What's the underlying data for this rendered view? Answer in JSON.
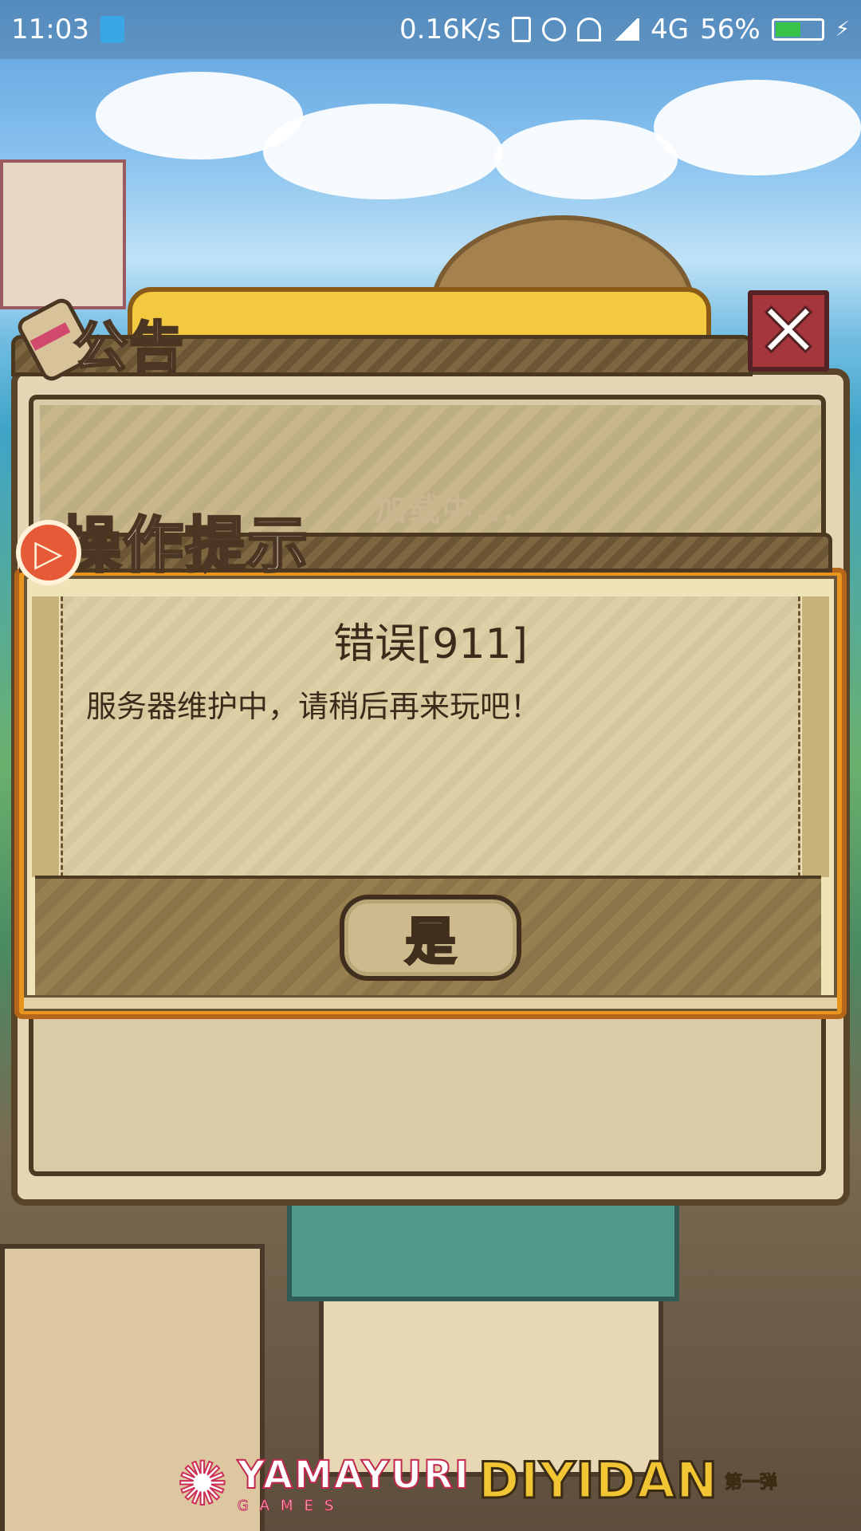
{
  "status_bar": {
    "time": "11:03",
    "network_speed": "0.16K/s",
    "network_type": "4G",
    "battery_percent": "56%",
    "battery_level": 0.56,
    "icons": [
      "battery-saver-icon",
      "vibrate-icon",
      "alarm-icon",
      "wifi-icon",
      "signal-icon",
      "battery-icon",
      "charging-icon"
    ]
  },
  "announcement": {
    "title": "公告",
    "loading_text": "加载中...",
    "close_label": "✕"
  },
  "tip_dialog": {
    "title": "操作提示",
    "error_title": "错误[911]",
    "message": "服务器维护中，请稍后再来玩吧！",
    "confirm_label": "是"
  },
  "footer": {
    "brand_left": "YAMAYURI",
    "brand_left_sub": "GAMES",
    "brand_right": "DIYIDAN",
    "brand_right_sub": "第一弹"
  },
  "colors": {
    "dialog_frame": "#e8951e",
    "close_button": "#a5363c",
    "text_dark": "#3a2b1a"
  }
}
